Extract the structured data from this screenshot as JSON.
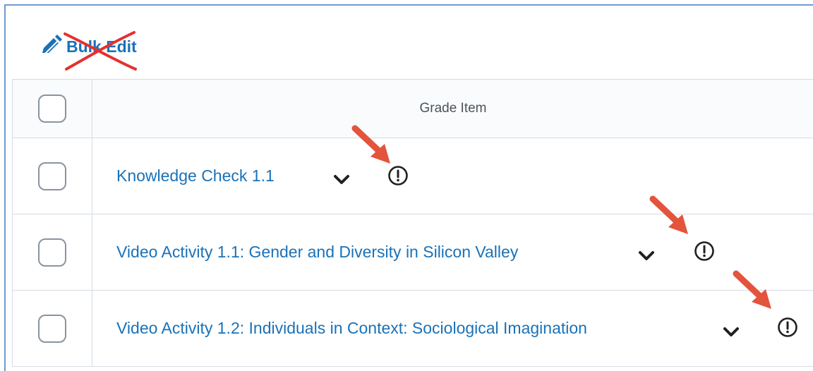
{
  "toolbar": {
    "bulk_edit_label": "Bulk Edit"
  },
  "table": {
    "header": {
      "grade_item_label": "Grade Item"
    },
    "rows": [
      {
        "title": "Knowledge Check 1.1"
      },
      {
        "title": "Video Activity 1.1: Gender and Diversity in Silicon Valley"
      },
      {
        "title": "Video Activity 1.2: Individuals in Context: Sociological Imagination"
      }
    ]
  },
  "icons": {
    "edit": "pencil-icon",
    "strike": "cross-out-mark",
    "menu": "chevron-down-icon",
    "alert": "exclamation-circle-icon",
    "annotation": "red-arrow-annotation"
  },
  "colors": {
    "link": "#1a72b8",
    "annotation": "#e4533c",
    "frame_border": "#6d9bd1"
  }
}
